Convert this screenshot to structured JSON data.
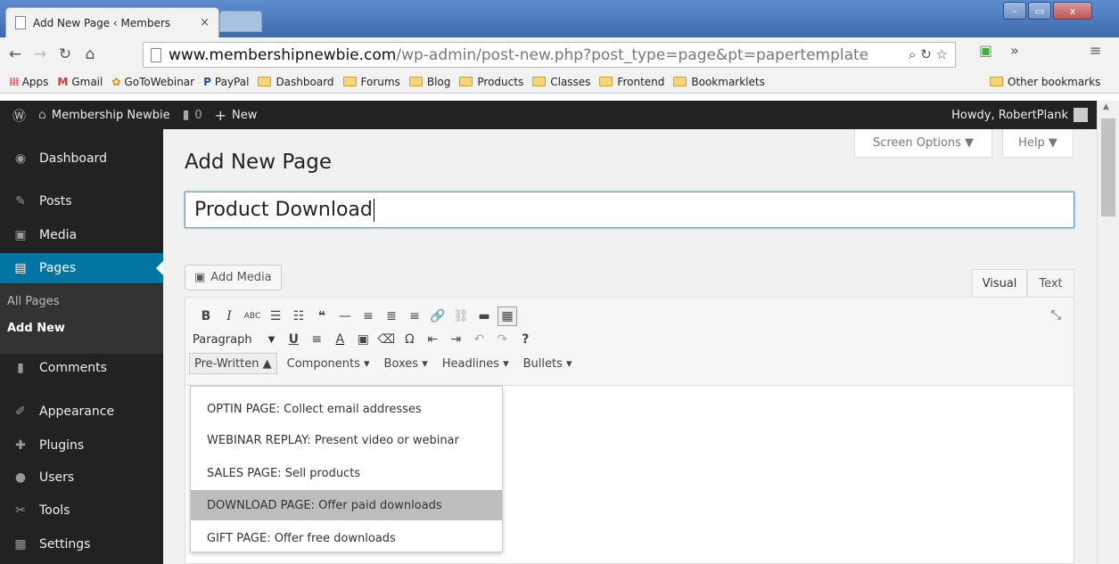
{
  "browser": {
    "tab_title": "Add New Page ‹ Members",
    "tab_close": "×",
    "url_host": "www.membershipnewbie.com",
    "url_path": "/wp-admin/post-new.php?post_type=page&pt=papertemplate",
    "bookmarks": [
      "Apps",
      "Gmail",
      "GoToWebinar",
      "PayPal",
      "Dashboard",
      "Forums",
      "Blog",
      "Products",
      "Classes",
      "Frontend",
      "Bookmarklets"
    ],
    "other_bookmarks": "Other bookmarks",
    "apps_icon_glyph": "⁞⁞⁞",
    "gmail_icon_glyph": "M",
    "gotowebinar_icon_glyph": "✿",
    "paypal_icon_glyph": "P"
  },
  "adminbar": {
    "site_name": "Membership Newbie",
    "comments_count": "0",
    "new_label": "New",
    "howdy": "Howdy, RobertPlank"
  },
  "sidebar": {
    "items": [
      {
        "label": "Dashboard",
        "icon": "dashboard-icon",
        "glyph": "◉"
      },
      {
        "label": "Posts",
        "icon": "pin-icon",
        "glyph": "✎"
      },
      {
        "label": "Media",
        "icon": "media-icon",
        "glyph": "▣"
      },
      {
        "label": "Pages",
        "icon": "pages-icon",
        "glyph": "▤"
      },
      {
        "label": "Comments",
        "icon": "comment-icon",
        "glyph": "▮"
      },
      {
        "label": "Appearance",
        "icon": "brush-icon",
        "glyph": "✐"
      },
      {
        "label": "Plugins",
        "icon": "plug-icon",
        "glyph": "✚"
      },
      {
        "label": "Users",
        "icon": "user-icon",
        "glyph": "●"
      },
      {
        "label": "Tools",
        "icon": "wrench-icon",
        "glyph": "✂"
      },
      {
        "label": "Settings",
        "icon": "settings-icon",
        "glyph": "▦"
      }
    ],
    "submenu": [
      "All Pages",
      "Add New"
    ]
  },
  "main": {
    "screen_options": "Screen Options ▼",
    "help": "Help ▼",
    "page_title": "Add New Page",
    "title_value": "Product Download",
    "add_media": "Add Media",
    "tab_visual": "Visual",
    "tab_text": "Text",
    "format_select": "Paragraph",
    "template_menus": [
      "Pre-Written ▲",
      "Components ▾",
      "Boxes ▾",
      "Headlines ▾",
      "Bullets ▾"
    ],
    "dropdown_items": [
      "OPTIN PAGE: Collect email addresses",
      "WEBINAR REPLAY: Present video or webinar",
      "SALES PAGE: Sell products",
      "DOWNLOAD PAGE: Offer paid downloads",
      "GIFT PAGE: Offer free downloads"
    ]
  },
  "toolbar_row1": [
    "B",
    "I",
    "ABC",
    "☰",
    "☷",
    "❝",
    "—",
    "≡",
    "≣",
    "≡",
    "🔗",
    "⛓",
    "▬",
    "▦"
  ],
  "toolbar_row2": [
    "U",
    "≡",
    "A",
    "▣",
    "⌫",
    "Ω",
    "⇤",
    "⇥",
    "↶",
    "↷",
    "?"
  ],
  "fullscreen_glyph": "⤡",
  "colors": {
    "admin_bg": "#222222",
    "active_menu": "#0074a2",
    "dropdown_hover": "#bdbdbd"
  }
}
